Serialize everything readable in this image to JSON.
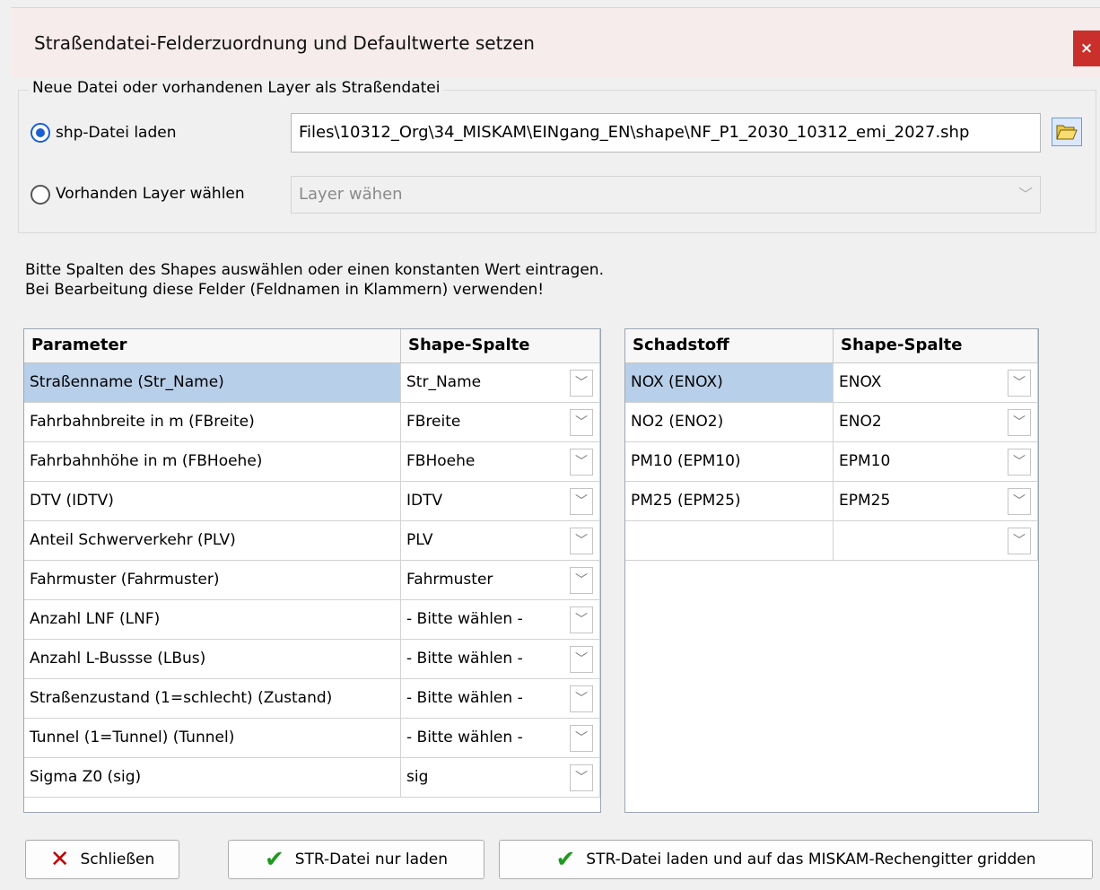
{
  "window": {
    "title": "Straßendatei-Felderzuordnung und Defaultwerte setzen",
    "close_label": "×"
  },
  "source": {
    "group_label": "Neue Datei oder vorhandenen Layer als Straßendatei",
    "option_shp_label": "shp-Datei laden",
    "shp_path": "Files\\10312_Org\\34_MISKAM\\EINgang_EN\\shape\\NF_P1_2030_10312_emi_2027.shp",
    "option_layer_label": "Vorhanden Layer wählen",
    "layer_placeholder": "Layer wähen",
    "selected_option": "shp"
  },
  "instructions": {
    "line1": "Bitte Spalten des Shapes auswählen oder einen konstanten Wert eintragen.",
    "line2": "Bei Bearbeitung diese Felder (Feldnamen in Klammern) verwenden!"
  },
  "param_table": {
    "headers": [
      "Parameter",
      "Shape-Spalte"
    ],
    "rows": [
      {
        "param": "Straßenname (Str_Name)",
        "col": "Str_Name"
      },
      {
        "param": "Fahrbahnbreite in m (FBreite)",
        "col": "FBreite"
      },
      {
        "param": "Fahrbahnhöhe in m (FBHoehe)",
        "col": "FBHoehe"
      },
      {
        "param": "DTV (IDTV)",
        "col": "IDTV"
      },
      {
        "param": "Anteil Schwerverkehr (PLV)",
        "col": "PLV"
      },
      {
        "param": "Fahrmuster (Fahrmuster)",
        "col": "Fahrmuster"
      },
      {
        "param": "Anzahl LNF (LNF)",
        "col": "- Bitte wählen -"
      },
      {
        "param": "Anzahl L-Bussse (LBus)",
        "col": "- Bitte wählen -"
      },
      {
        "param": "Straßenzustand (1=schlecht) (Zustand)",
        "col": "- Bitte wählen -"
      },
      {
        "param": "Tunnel (1=Tunnel) (Tunnel)",
        "col": "- Bitte wählen -"
      },
      {
        "param": "Sigma Z0 (sig)",
        "col": "sig"
      }
    ]
  },
  "pollutant_table": {
    "headers": [
      "Schadstoff",
      "Shape-Spalte"
    ],
    "rows": [
      {
        "param": "NOX (ENOX)",
        "col": "ENOX"
      },
      {
        "param": "NO2 (ENO2)",
        "col": "ENO2"
      },
      {
        "param": "PM10 (EPM10)",
        "col": "EPM10"
      },
      {
        "param": "PM25 (EPM25)",
        "col": "EPM25"
      },
      {
        "param": "",
        "col": ""
      }
    ]
  },
  "buttons": {
    "close": "Schließen",
    "load_only": "STR-Datei nur laden",
    "load_grid": "STR-Datei laden und auf das MISKAM-Rechengitter gridden"
  },
  "icons": {
    "close_x": "✕",
    "check": "✔",
    "folder": "folder-open-icon",
    "chevron": "﹀"
  }
}
